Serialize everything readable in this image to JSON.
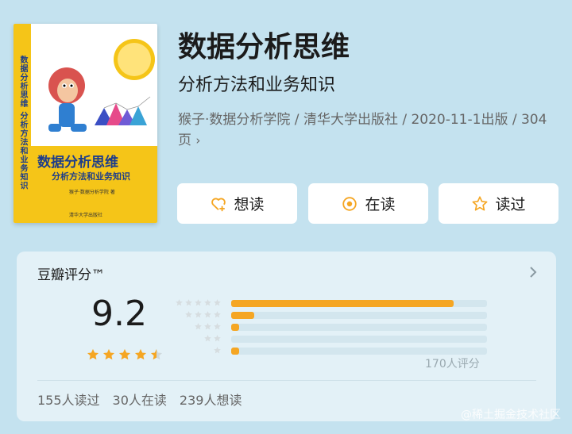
{
  "book": {
    "title": "数据分析思维",
    "subtitle": "分析方法和业务知识",
    "meta": "猴子·数据分析学院 / 清华大学出版社 / 2020-11-1出版 / 304页",
    "meta_chevron": "›"
  },
  "cover": {
    "spine_text": "数据分析思维 分析方法和业务知识",
    "title": "数据分析思维",
    "subtitle": "分析方法和业务知识",
    "author": "猴子·数据分析学院 著",
    "publisher": "清华大学出版社"
  },
  "actions": {
    "want_label": "想读",
    "reading_label": "在读",
    "read_label": "读过"
  },
  "rating": {
    "label": "豆瓣评分™",
    "score": "9.2",
    "stars_filled": 4.5,
    "distribution": [
      {
        "stars": 5,
        "fraction": 0.87
      },
      {
        "stars": 4,
        "fraction": 0.09
      },
      {
        "stars": 3,
        "fraction": 0.03
      },
      {
        "stars": 2,
        "fraction": 0.0
      },
      {
        "stars": 1,
        "fraction": 0.03
      }
    ],
    "count_text": "170人评分"
  },
  "readers": {
    "read": "155人读过",
    "reading": "30人在读",
    "want": "239人想读"
  },
  "watermark": "@稀土掘金技术社区",
  "colors": {
    "background": "#c4e2ef",
    "accent": "#f5a623",
    "cover_yellow": "#f5c518",
    "cover_blue": "#1d3d8a"
  }
}
